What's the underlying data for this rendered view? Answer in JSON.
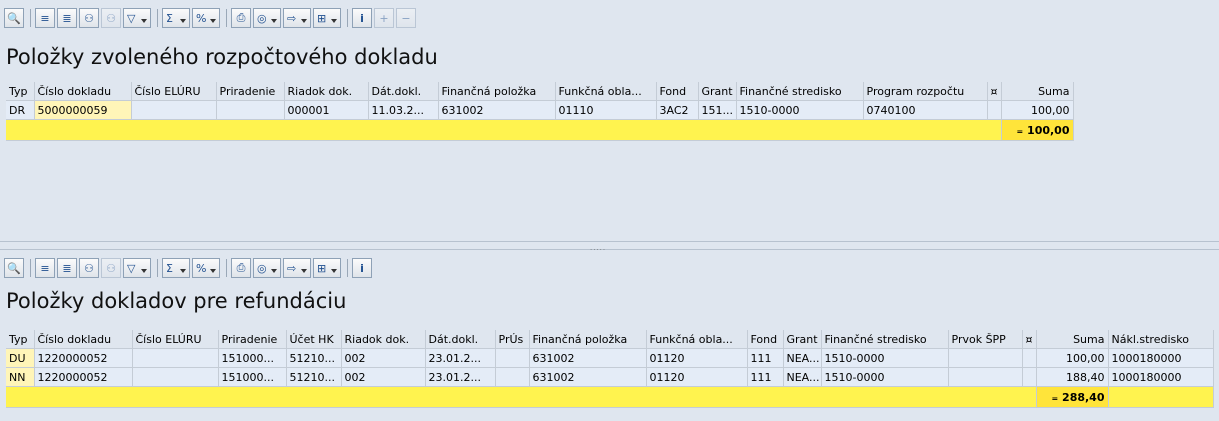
{
  "toolbar_icons": [
    "details-icon",
    "sort-ascending-icon",
    "sort-descending-icon",
    "find-icon",
    "find-next-icon",
    "filter-icon",
    "total-icon",
    "subtotals-icon",
    "print-icon",
    "views-icon",
    "export-icon",
    "layout-icon",
    "info-icon",
    "insert-row-icon",
    "delete-row-icon"
  ],
  "top": {
    "title": "Položky zvoleného rozpočtového dokladu",
    "columns": [
      "Typ",
      "Číslo dokladu",
      "Číslo ELÚRU",
      "Priradenie",
      "Riadok dok.",
      "Dát.dokl.",
      "Finančná položka",
      "Funkčná obla...",
      "Fond",
      "Grant",
      "Finančné stredisko",
      "Program rozpočtu",
      "¤",
      "Suma"
    ],
    "rows": [
      {
        "typ": "DR",
        "cislo": "5000000059",
        "eluru": "",
        "priradenie": "",
        "riadok": "000001",
        "dat": "11.03.2...",
        "fin_polozka": "631002",
        "funkcna": "01110",
        "fond": "3AC2",
        "grant": "151...",
        "stredisko": "1510-0000",
        "program": "0740100",
        "cur": "",
        "suma": "100,00"
      }
    ],
    "total": "100,00",
    "total_marker": "="
  },
  "bottom": {
    "title": "Položky dokladov pre refundáciu",
    "columns": [
      "Typ",
      "Číslo dokladu",
      "Číslo ELÚRU",
      "Priradenie",
      "Účet HK",
      "Riadok dok.",
      "Dát.dokl.",
      "PrÚs",
      "Finančná položka",
      "Funkčná obla...",
      "Fond",
      "Grant",
      "Finančné stredisko",
      "Prvok ŠPP",
      "¤",
      "Suma",
      "Nákl.stredisko"
    ],
    "rows": [
      {
        "typ": "DU",
        "cislo": "1220000052",
        "eluru": "",
        "priradenie": "151000...",
        "ucet": "51210...",
        "riadok": "002",
        "dat": "23.01.2...",
        "prus": "",
        "fin_polozka": "631002",
        "funkcna": "01120",
        "fond": "111",
        "grant": "NEA...",
        "stredisko": "1510-0000",
        "spp": "",
        "cur": "",
        "suma": "100,00",
        "nakl": "1000180000"
      },
      {
        "typ": "NN",
        "cislo": "1220000052",
        "eluru": "",
        "priradenie": "151000...",
        "ucet": "51210...",
        "riadok": "002",
        "dat": "23.01.2...",
        "prus": "",
        "fin_polozka": "631002",
        "funkcna": "01120",
        "fond": "111",
        "grant": "NEA...",
        "stredisko": "1510-0000",
        "spp": "",
        "cur": "",
        "suma": "188,40",
        "nakl": "1000180000"
      }
    ],
    "total": "288,40",
    "total_marker": "="
  },
  "splitter_grip": "....."
}
